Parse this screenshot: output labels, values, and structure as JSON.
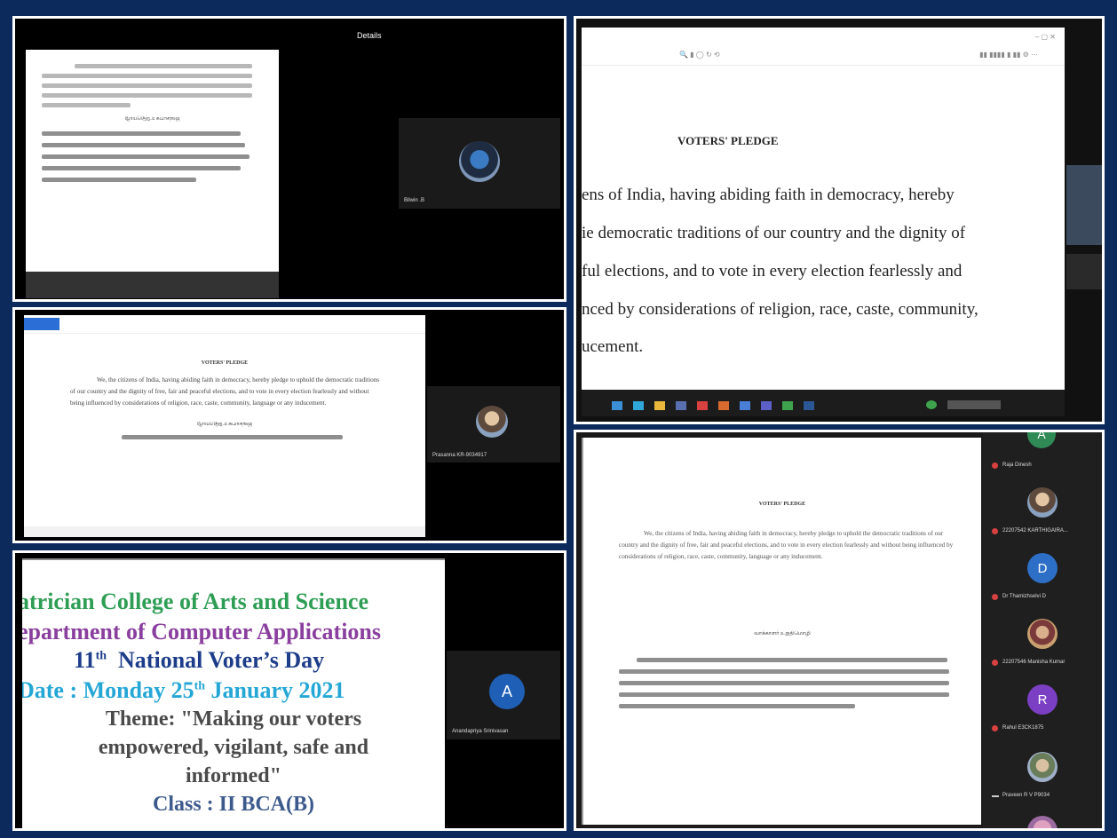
{
  "panel1": {
    "header": "Details",
    "participant": "Bilwin .B",
    "pledge_heading_mirrored": "ஜனநாயக உறுதிமொழி"
  },
  "panel2": {
    "heading": "VOTERS' PLEDGE",
    "lines": [
      "ens of India, having abiding faith in democracy, hereby",
      "ie democratic traditions of our country and the dignity of",
      "ful elections, and to vote in every election fearlessly and",
      "nced by considerations of religion, race, caste, community,",
      "ucement."
    ]
  },
  "panel3": {
    "heading": "VOTERS' PLEDGE",
    "paragraph": "We, the citizens of India, having abiding faith in democracy, hereby pledge to uphold the democratic traditions of our country and the dignity of free, fair and peaceful elections, and to vote in every election fearlessly and without being influenced by considerations of religion, race, caste, community, language or any inducement.",
    "tamil_heading_mirrored": "ஜனநாயக உறுதிமொழி",
    "participant": "Prasanna KR-9034917"
  },
  "panel4": {
    "lines": [
      "atrician College of Arts and Science",
      "epartment of Computer Applications",
      "11",
      "National Voter’s Day",
      "Date : Monday 25",
      "January 2021",
      "Theme: \"Making our voters",
      "empowered, vigilant, safe and",
      "informed\"",
      "Class : II BCA(B)"
    ],
    "ordinal_th": "th",
    "avatar_letter": "A",
    "participant": "Anandapriya Srinivasan"
  },
  "panel5": {
    "heading": "VOTERS' PLEDGE",
    "paragraph": "We, the citizens of India, having abiding faith in democracy, hereby pledge to uphold the democratic traditions of our country and the dignity of free, fair and peaceful elections, and to vote in every election fearlessly and without being influenced by considerations of religion, race, caste, community, language or any inducement.",
    "tamil_heading": "வாக்காளர் உறுதிமொழி",
    "participants": [
      {
        "name": "Raja Dinesh",
        "avatar": ""
      },
      {
        "name": "22207542 KARTHIGAIRA...",
        "avatar": ""
      },
      {
        "name": "Dr Thamizhselvi D",
        "avatar": "D"
      },
      {
        "name": "22207546 Manisha Kumar",
        "avatar": ""
      },
      {
        "name": "Rahul E3CK1875",
        "avatar": "R"
      },
      {
        "name": "Praveen R V P9034",
        "avatar": ""
      }
    ],
    "top_avatar": "A"
  },
  "colors": {
    "frame": "#0d2a5c",
    "green": "#2f9e55",
    "purple": "#8a3f9e",
    "navy": "#1d3d8a",
    "cyan": "#25a7d6",
    "dark_grey": "#4a4a4a",
    "slate": "#3c5a8c"
  }
}
